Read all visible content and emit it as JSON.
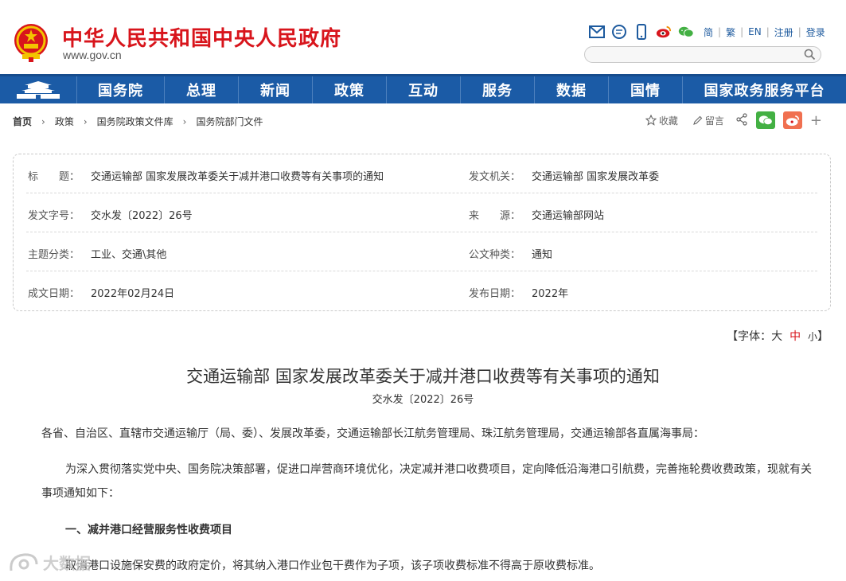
{
  "header": {
    "title": "中华人民共和国中央人民政府",
    "url": "www.gov.cn",
    "lang_links": [
      "简",
      "繁",
      "EN",
      "注册",
      "登录"
    ],
    "search_placeholder": ""
  },
  "nav": {
    "items": [
      "国务院",
      "总理",
      "新闻",
      "政策",
      "互动",
      "服务",
      "数据",
      "国情",
      "国家政务服务平台"
    ]
  },
  "breadcrumb": [
    "首页",
    "政策",
    "国务院政策文件库",
    "国务院部门文件"
  ],
  "actions": {
    "favorite": "收藏",
    "comment": "留言"
  },
  "info": {
    "rows": [
      {
        "l1": "标　　题：",
        "v1": "交通运输部 国家发展改革委关于减并港口收费等有关事项的通知",
        "l2": "发文机关：",
        "v2": "交通运输部 国家发展改革委"
      },
      {
        "l1": "发文字号：",
        "v1": "交水发〔2022〕26号",
        "l2": "来　　源：",
        "v2": "交通运输部网站"
      },
      {
        "l1": "主题分类：",
        "v1": "工业、交通\\其他",
        "l2": "公文种类：",
        "v2": "通知"
      },
      {
        "l1": "成文日期：",
        "v1": "2022年02月24日",
        "l2": "发布日期：",
        "v2": "2022年"
      }
    ]
  },
  "fontsize": {
    "prefix": "【字体：",
    "large": "大",
    "medium": "中",
    "small": "小",
    "suffix": "】"
  },
  "document": {
    "title": "交通运输部 国家发展改革委关于减并港口收费等有关事项的通知",
    "number": "交水发〔2022〕26号",
    "salutation": "各省、自治区、直辖市交通运输厅（局、委）、发展改革委，交通运输部长江航务管理局、珠江航务管理局，交通运输部各直属海事局：",
    "intro": "为深入贯彻落实党中央、国务院决策部署，促进口岸营商环境优化，决定减并港口收费项目，定向降低沿海港口引航费，完善拖轮费收费政策，现就有关事项通知如下：",
    "section1": "一、减并港口经营服务性收费项目",
    "para1": "取消港口设施保安费的政府定价，将其纳入港口作业包干费作为子项，该子项收费标准不得高于原收费标准。"
  },
  "watermark": "大数据"
}
